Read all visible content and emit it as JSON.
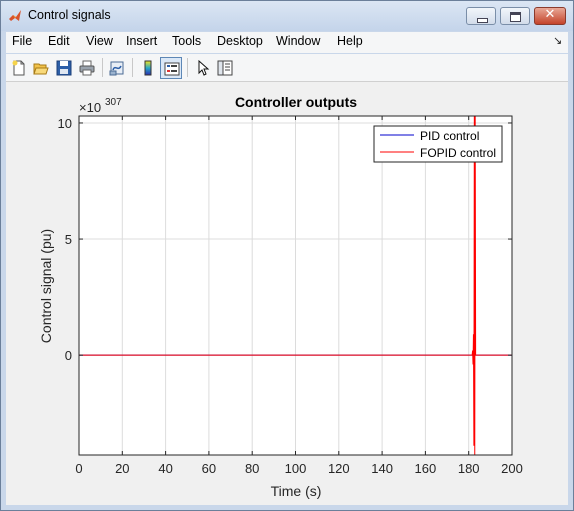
{
  "window": {
    "title": "Control signals",
    "close_glyph": "✕"
  },
  "menubar": {
    "items": [
      "File",
      "Edit",
      "View",
      "Insert",
      "Tools",
      "Desktop",
      "Window",
      "Help"
    ],
    "overflow_glyph": "↘"
  },
  "toolbar": {
    "buttons": [
      "new-figure-icon",
      "open-file-icon",
      "save-icon",
      "print-icon",
      "link-plot-icon",
      "insert-colorbar-icon",
      "insert-legend-icon",
      "edit-plot-pointer-icon",
      "property-inspector-icon"
    ]
  },
  "chart_data": {
    "type": "line",
    "title": "Controller outputs",
    "xlabel": "Time (s)",
    "ylabel": "Control signal (pu)",
    "exponent_label": "×10",
    "exponent_power": "307",
    "xlim": [
      0,
      200
    ],
    "ylim": [
      -4.3,
      10.3
    ],
    "xticks": [
      "0",
      "20",
      "40",
      "60",
      "80",
      "100",
      "120",
      "140",
      "160",
      "180",
      "200"
    ],
    "yticks": [
      "0",
      "5",
      "10"
    ],
    "grid": true,
    "legend_location": "top-right",
    "series": [
      {
        "name": "PID control",
        "color": "#0000cc",
        "x": [
          0,
          200
        ],
        "y": [
          0,
          0
        ]
      },
      {
        "name": "FOPID control",
        "color": "#ff0000",
        "x": [
          0,
          181.6,
          181.8,
          182.0,
          182.2,
          182.4,
          182.6,
          182.8,
          183.0,
          183.2,
          183.4,
          200
        ],
        "y": [
          0,
          0,
          0.2,
          -0.4,
          0.9,
          -3.9,
          10.3,
          -4.3,
          10.3,
          0,
          0,
          0
        ]
      }
    ]
  }
}
